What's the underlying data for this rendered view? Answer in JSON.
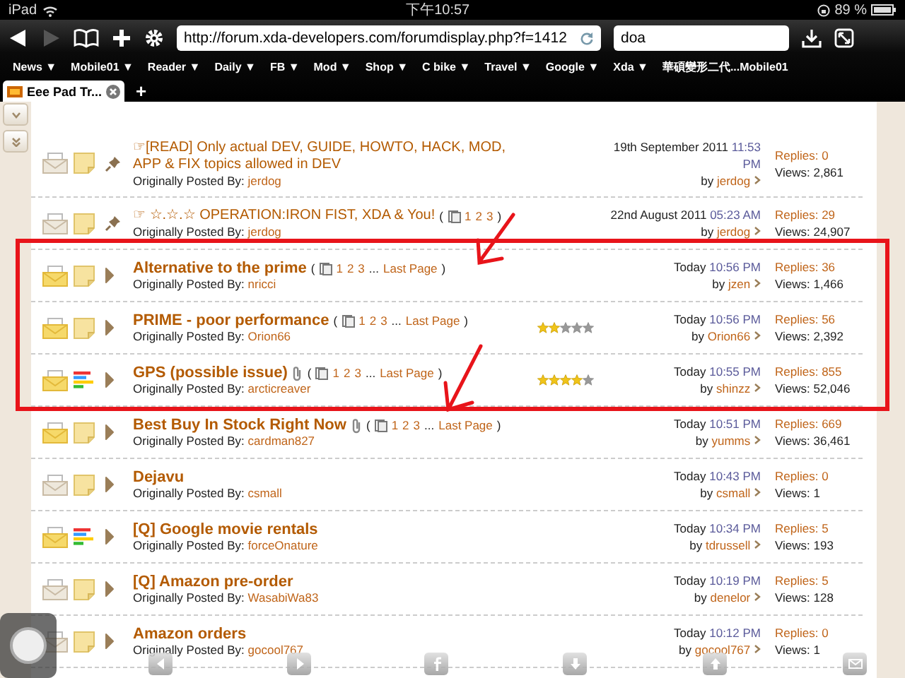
{
  "status_bar": {
    "device": "iPad",
    "time": "下午10:57",
    "battery": "89 %"
  },
  "toolbar": {
    "back_disabled": false,
    "forward_disabled": true,
    "url": "http://forum.xda-developers.com/forumdisplay.php?f=1412",
    "search": "doa"
  },
  "bookmarks": [
    "News ▼",
    "Mobile01 ▼",
    "Reader ▼",
    "Daily ▼",
    "FB ▼",
    "Mod ▼",
    "Shop ▼",
    "C bike ▼",
    "Travel ▼",
    "Google ▼",
    "Xda ▼",
    "華碩變形二代...Mobile01"
  ],
  "tabs": [
    {
      "title": "Eee Pad Tr...",
      "selected": true
    }
  ],
  "new_tab": "+",
  "threads": [
    {
      "kind": "sticky",
      "bars_icon": false,
      "unread": false,
      "title": "☞[READ] Only actual DEV, GUIDE, HOWTO, HACK, MOD, APP & FIX topics allowed in DEV",
      "attachment": false,
      "posted_label": "Originally Posted By:",
      "starter": "jerdog",
      "date": "19th September 2011",
      "time": "11:53 PM",
      "by": "by",
      "last_poster": "jerdog",
      "replies": "Replies: 0",
      "views": "Views: 2,861"
    },
    {
      "kind": "sticky",
      "bars_icon": false,
      "unread": false,
      "title": "☞ ☆.☆.☆ OPERATION:IRON FIST, XDA & You!",
      "attachment": false,
      "pages": [
        {
          "label": "(",
          "kind": "text"
        },
        {
          "label": "1",
          "kind": "link"
        },
        {
          "label": "2",
          "kind": "link"
        },
        {
          "label": "3",
          "kind": "link"
        },
        {
          "label": ")",
          "kind": "text"
        }
      ],
      "posted_label": "Originally Posted By:",
      "starter": "jerdog",
      "date": "22nd August 2011",
      "time": "05:23 AM",
      "by": "by",
      "last_poster": "jerdog",
      "replies": "Replies: 29",
      "views": "Views: 24,907"
    },
    {
      "kind": "normal",
      "bars_icon": false,
      "unread": true,
      "title": "Alternative to the prime",
      "attachment": false,
      "pages": [
        {
          "label": "(",
          "kind": "text"
        },
        {
          "label": "1",
          "kind": "link"
        },
        {
          "label": "2",
          "kind": "link"
        },
        {
          "label": "3",
          "kind": "link"
        },
        {
          "label": "...",
          "kind": "text"
        },
        {
          "label": "Last Page",
          "kind": "link"
        },
        {
          "label": ")",
          "kind": "text"
        }
      ],
      "posted_label": "Originally Posted By:",
      "starter": "nricci",
      "date": "Today",
      "time": "10:56 PM",
      "by": "by",
      "last_poster": "jzen",
      "replies": "Replies: 36",
      "views": "Views: 1,466"
    },
    {
      "kind": "normal",
      "bars_icon": false,
      "unread": true,
      "title": "PRIME - poor performance",
      "attachment": false,
      "pages": [
        {
          "label": "(",
          "kind": "text"
        },
        {
          "label": "1",
          "kind": "link"
        },
        {
          "label": "2",
          "kind": "link"
        },
        {
          "label": "3",
          "kind": "link"
        },
        {
          "label": "...",
          "kind": "text"
        },
        {
          "label": "Last Page",
          "kind": "link"
        },
        {
          "label": ")",
          "kind": "text"
        }
      ],
      "stars": 2,
      "posted_label": "Originally Posted By:",
      "starter": "Orion66",
      "date": "Today",
      "time": "10:56 PM",
      "by": "by",
      "last_poster": "Orion66",
      "replies": "Replies: 56",
      "views": "Views: 2,392"
    },
    {
      "kind": "normal",
      "bars_icon": true,
      "unread": true,
      "title": "GPS (possible issue)",
      "attachment": true,
      "pages": [
        {
          "label": "(",
          "kind": "text"
        },
        {
          "label": "1",
          "kind": "link"
        },
        {
          "label": "2",
          "kind": "link"
        },
        {
          "label": "3",
          "kind": "link"
        },
        {
          "label": "...",
          "kind": "text"
        },
        {
          "label": "Last Page",
          "kind": "link"
        },
        {
          "label": ")",
          "kind": "text"
        }
      ],
      "stars": 4,
      "posted_label": "Originally Posted By:",
      "starter": "arcticreaver",
      "date": "Today",
      "time": "10:55 PM",
      "by": "by",
      "last_poster": "shinzz",
      "replies": "Replies: 855",
      "views": "Views: 52,046"
    },
    {
      "kind": "normal",
      "bars_icon": false,
      "unread": true,
      "title": "Best Buy In Stock Right Now",
      "attachment": true,
      "pages": [
        {
          "label": "(",
          "kind": "text"
        },
        {
          "label": "1",
          "kind": "link"
        },
        {
          "label": "2",
          "kind": "link"
        },
        {
          "label": "3",
          "kind": "link"
        },
        {
          "label": "...",
          "kind": "text"
        },
        {
          "label": "Last Page",
          "kind": "link"
        },
        {
          "label": ")",
          "kind": "text"
        }
      ],
      "posted_label": "Originally Posted By:",
      "starter": "cardman827",
      "date": "Today",
      "time": "10:51 PM",
      "by": "by",
      "last_poster": "yumms",
      "replies": "Replies: 669",
      "views": "Views: 36,461"
    },
    {
      "kind": "normal",
      "bars_icon": false,
      "unread": false,
      "title": "Dejavu",
      "attachment": false,
      "posted_label": "Originally Posted By:",
      "starter": "csmall",
      "date": "Today",
      "time": "10:43 PM",
      "by": "by",
      "last_poster": "csmall",
      "replies": "Replies: 0",
      "views": "Views: 1"
    },
    {
      "kind": "normal",
      "bars_icon": true,
      "unread": true,
      "title": "[Q] Google movie rentals",
      "attachment": false,
      "posted_label": "Originally Posted By:",
      "starter": "forceOnature",
      "date": "Today",
      "time": "10:34 PM",
      "by": "by",
      "last_poster": "tdrussell",
      "replies": "Replies: 5",
      "views": "Views: 193"
    },
    {
      "kind": "normal",
      "bars_icon": false,
      "unread": false,
      "title": "[Q] Amazon pre-order",
      "attachment": false,
      "posted_label": "Originally Posted By:",
      "starter": "WasabiWa83",
      "date": "Today",
      "time": "10:19 PM",
      "by": "by",
      "last_poster": "denelor",
      "replies": "Replies: 5",
      "views": "Views: 128"
    },
    {
      "kind": "normal",
      "bars_icon": false,
      "unread": false,
      "title": "Amazon orders",
      "attachment": false,
      "posted_label": "Originally Posted By:",
      "starter": "gocool767",
      "date": "Today",
      "time": "10:12 PM",
      "by": "by",
      "last_poster": "gocool767",
      "replies": "Replies: 0",
      "views": "Views: 1"
    }
  ]
}
